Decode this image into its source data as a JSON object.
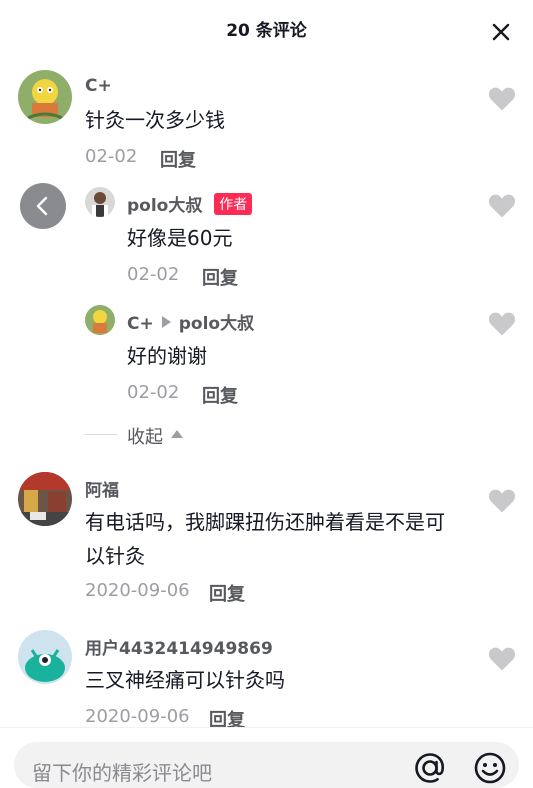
{
  "header": {
    "title": "20 条评论"
  },
  "comments": [
    {
      "username": "C+",
      "content": "针灸一次多少钱",
      "date": "02-02",
      "reply_label": "回复",
      "avatar": "cartoon-character-avatar",
      "replies": [
        {
          "username": "polo大叔",
          "author_badge": "作者",
          "content": "好像是60元",
          "date": "02-02",
          "reply_label": "回复",
          "avatar": "man-photo-avatar"
        },
        {
          "username": "C+",
          "reply_to": "polo大叔",
          "content": "好的谢谢",
          "date": "02-02",
          "reply_label": "回复",
          "avatar": "cartoon-character-avatar"
        }
      ],
      "collapse_label": "收起"
    },
    {
      "username": "阿福",
      "content": "有电话吗，我脚踝扭伤还肿着看是不是可以针灸",
      "date": "2020-09-06",
      "reply_label": "回复",
      "avatar": "street-photo-avatar"
    },
    {
      "username": "用户4432414949869",
      "content": "三叉神经痛可以针灸吗",
      "date": "2020-09-06",
      "reply_label": "回复",
      "avatar": "green-monster-avatar"
    }
  ],
  "footer": {
    "input_placeholder": "留下你的精彩评论吧",
    "at_icon": "at-icon",
    "emoji_icon": "emoji-icon"
  },
  "colors": {
    "author_badge": "#fe2c55",
    "like_icon": "#c9c9cc",
    "secondary_text": "#9c9ea3"
  }
}
